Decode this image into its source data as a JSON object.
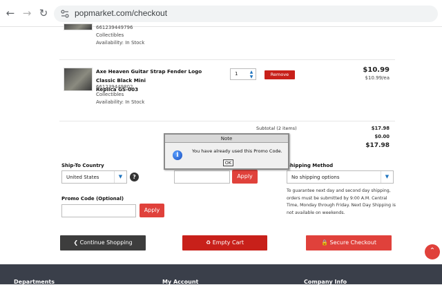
{
  "browser": {
    "url": "popmarket.com/checkout"
  },
  "items": [
    {
      "sku": "661239449796",
      "category": "Collectibles",
      "availability": "Availability: In Stock"
    },
    {
      "name_line1": "Axe Heaven Guitar Strap Fender Logo Classic Black Mini",
      "name_line2": "Replica GS-003",
      "sku": "661239449802",
      "category": "Collectibles",
      "availability": "Availability: In Stock",
      "quantity": "1",
      "remove_label": "Remove",
      "price": "$10.99",
      "unit_price": "$10.99/ea"
    }
  ],
  "summary": {
    "subtotal_label": "Subtotal (2 items)",
    "subtotal_value": "$17.98",
    "shipping_value": "$0.00",
    "total_value": "$17.98"
  },
  "ship_to": {
    "label": "Ship-To Country",
    "value": "United States"
  },
  "zip_apply_label": "Apply",
  "shipping_method": {
    "label": "Shipping Method",
    "value": "No shipping options",
    "note": "To guarantee next day and second day shipping, orders must be submitted by 9:00 A.M. Central Time, Monday through Friday. Next Day Shipping is not available on weekends."
  },
  "promo": {
    "label": "Promo Code (Optional)",
    "apply_label": "Apply",
    "value": ""
  },
  "buttons": {
    "continue": "Continue Shopping",
    "empty": "Empty Cart",
    "secure": "Secure Checkout"
  },
  "footer": {
    "col1": "Departments",
    "col2": "My Account",
    "col3": "Company Info"
  },
  "dialog": {
    "title": "Note",
    "message": "You have already used this Promo Code.",
    "ok_label": "OK"
  },
  "colors": {
    "accent_red": "#e0413b",
    "dark_button": "#3d3d3d",
    "footer_bg": "#3a3f4a"
  }
}
